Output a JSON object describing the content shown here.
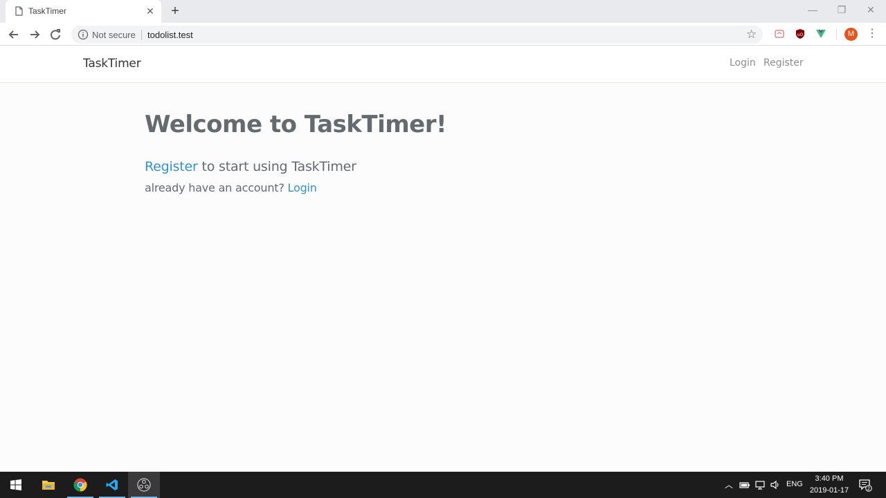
{
  "browser": {
    "tab_title": "TaskTimer",
    "tab_close": "✕",
    "new_tab": "+",
    "not_secure": "Not secure",
    "url": "todolist.test",
    "avatar_letter": "M",
    "icons": [
      "page-icon",
      "back-arrow-icon",
      "forward-arrow-icon",
      "reload-icon",
      "info-icon",
      "star-icon",
      "extension-icon",
      "ublock-icon",
      "vue-devtools-icon",
      "more-menu-icon"
    ]
  },
  "site": {
    "brand": "TaskTimer",
    "nav_login": "Login",
    "nav_register": "Register",
    "heading": "Welcome to TaskTimer!",
    "register_link": "Register",
    "register_suffix": " to start using TaskTimer",
    "account_prompt": "already have an account? ",
    "login_link": "Login"
  },
  "taskbar": {
    "apps": [
      "start-icon",
      "file-explorer-icon",
      "chrome-icon",
      "vscode-icon",
      "obs-icon"
    ],
    "lang": "ENG",
    "time": "3:40 PM",
    "date": "2019-01-17",
    "notification_count": "2"
  },
  "colors": {
    "link": "#3490dc",
    "text": "#636b6f",
    "avatar": "#e8541d"
  }
}
